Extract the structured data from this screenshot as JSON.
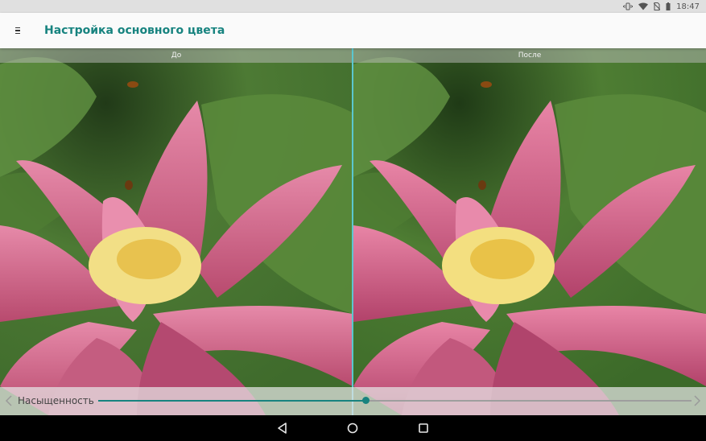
{
  "status_bar": {
    "time": "18:47",
    "icons": [
      "vibrate-icon",
      "wifi-icon",
      "no-sim-icon",
      "battery-icon"
    ]
  },
  "app_bar": {
    "menu_icon": "menu-icon",
    "title": "Настройка основного цвета",
    "accent_color": "#17837f"
  },
  "comparison": {
    "before_label": "До",
    "after_label": "После",
    "divider_color": "#5bc7cf"
  },
  "adjustment": {
    "label": "Насыщенность",
    "slider_value_fraction": 0.45,
    "prev_icon": "chevron-left-icon",
    "next_icon": "chevron-right-icon"
  },
  "nav_bar": {
    "icons": [
      "back-icon",
      "home-icon",
      "recents-icon"
    ]
  }
}
